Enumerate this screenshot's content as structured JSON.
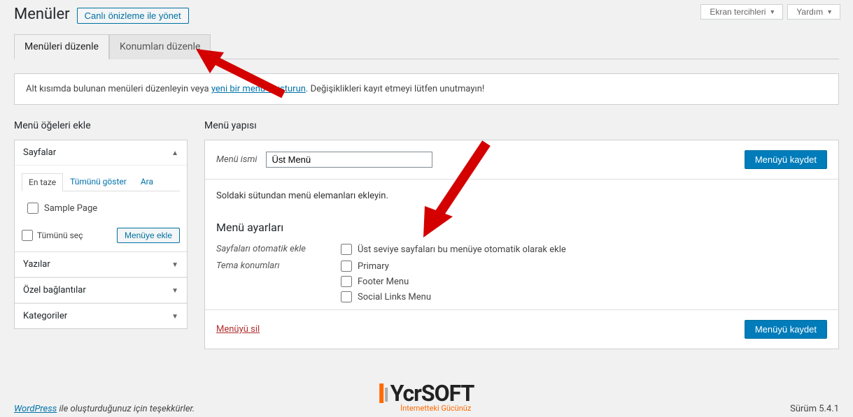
{
  "topbar": {
    "screen_options": "Ekran tercihleri",
    "help": "Yardım"
  },
  "page": {
    "title": "Menüler",
    "live_preview_button": "Canlı önizleme ile yönet"
  },
  "tabs": {
    "edit_menus": "Menüleri düzenle",
    "edit_locations": "Konumları düzenle"
  },
  "notice": {
    "pre": "Alt kısımda bulunan menüleri düzenleyin veya ",
    "link": "yeni bir menü oluşturun",
    "post": ". Değişiklikleri kayıt etmeyi lütfen unutmayın!"
  },
  "sidebar": {
    "heading": "Menü öğeleri ekle",
    "pages": {
      "title": "Sayfalar",
      "tabs": {
        "recent": "En taze",
        "all": "Tümünü göster",
        "search": "Ara"
      },
      "items": [
        {
          "label": "Sample Page"
        }
      ],
      "select_all": "Tümünü seç",
      "add_button": "Menüye ekle"
    },
    "posts": "Yazılar",
    "custom_links": "Özel bağlantılar",
    "categories": "Kategoriler"
  },
  "main": {
    "heading": "Menü yapısı",
    "menu_name_label": "Menü ismi",
    "menu_name_value": "Üst Menü",
    "save_button": "Menüyü kaydet",
    "hint": "Soldaki sütundan menü elemanları ekleyin.",
    "settings_heading": "Menü ayarları",
    "auto_add_label": "Sayfaları otomatik ekle",
    "auto_add_option": "Üst seviye sayfaları bu menüye otomatik olarak ekle",
    "locations_label": "Tema konumları",
    "locations": [
      "Primary",
      "Footer Menu",
      "Social Links Menu"
    ],
    "delete": "Menüyü sil",
    "save_button2": "Menüyü kaydet"
  },
  "logo": {
    "text": "YcrSOFT",
    "tagline": "İnternetteki Gücünüz"
  },
  "footer": {
    "wp": "WordPress",
    "thanks": " ile oluşturduğunuz için teşekkürler.",
    "version": "Sürüm 5.4.1"
  }
}
